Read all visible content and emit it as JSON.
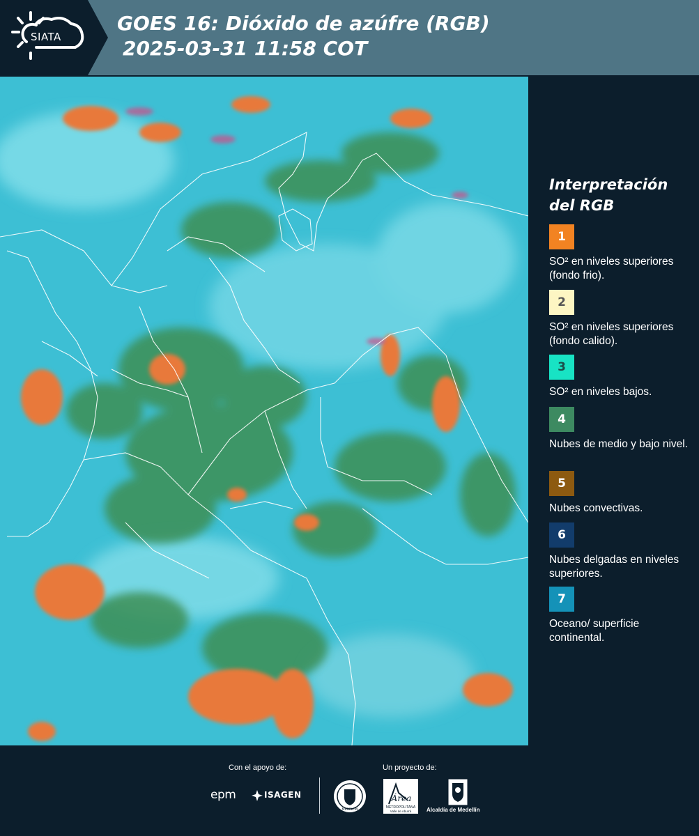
{
  "header": {
    "logo_text": "SIATA",
    "title_line1": "GOES 16: Dióxido de azúfre (RGB)",
    "title_line2": "2025-03-31 11:58 COT"
  },
  "legend": {
    "title_line1": "Interpretación",
    "title_line2": "del RGB",
    "items": [
      {
        "number": "1",
        "color": "#f28322",
        "text_color": "#ffffff",
        "description": "SO² en niveles superiores (fondo frio)."
      },
      {
        "number": "2",
        "color": "#fdf6c3",
        "text_color": "#555555",
        "description": "SO² en niveles superiores (fondo calido)."
      },
      {
        "number": "3",
        "color": "#18e3c4",
        "text_color": "#1b4f4a",
        "description": "SO² en niveles bajos."
      },
      {
        "number": "4",
        "color": "#3d8a61",
        "text_color": "#ffffff",
        "description": "Nubes de medio y bajo nivel."
      },
      {
        "number": "5",
        "color": "#8d5a10",
        "text_color": "#ffffff",
        "description": "Nubes convectivas."
      },
      {
        "number": "6",
        "color": "#123c6b",
        "text_color": "#ffffff",
        "description": "Nubes delgadas en niveles superiores."
      },
      {
        "number": "7",
        "color": "#1492b8",
        "text_color": "#ffffff",
        "description": "Oceano/ superficie continental."
      }
    ]
  },
  "footer": {
    "support_label": "Con el apoyo de:",
    "project_label": "Un proyecto de:",
    "sponsor_epm": "epm",
    "sponsor_isagen": "ISAGEN",
    "partner_area_word": "Área",
    "partner_area_sub1": "METROPOLITANA",
    "partner_area_sub2": "Valle de Aburrá",
    "partner_alcaldia": "Alcaldía de Medellín",
    "partner_seal_text": "MEDELLÍN"
  },
  "colors": {
    "header_bg": "#4f7585",
    "panel_bg": "#0c1e2c",
    "map_cyan": "#3dbfd4",
    "vegetation_green": "#3e8f55",
    "convective_orange": "#e8793a"
  },
  "icons": [
    "sun-cloud-logo-icon",
    "epm-logo-icon",
    "isagen-logo-icon",
    "medellin-seal-icon",
    "area-metropolitana-logo-icon",
    "alcaldia-shield-icon"
  ]
}
